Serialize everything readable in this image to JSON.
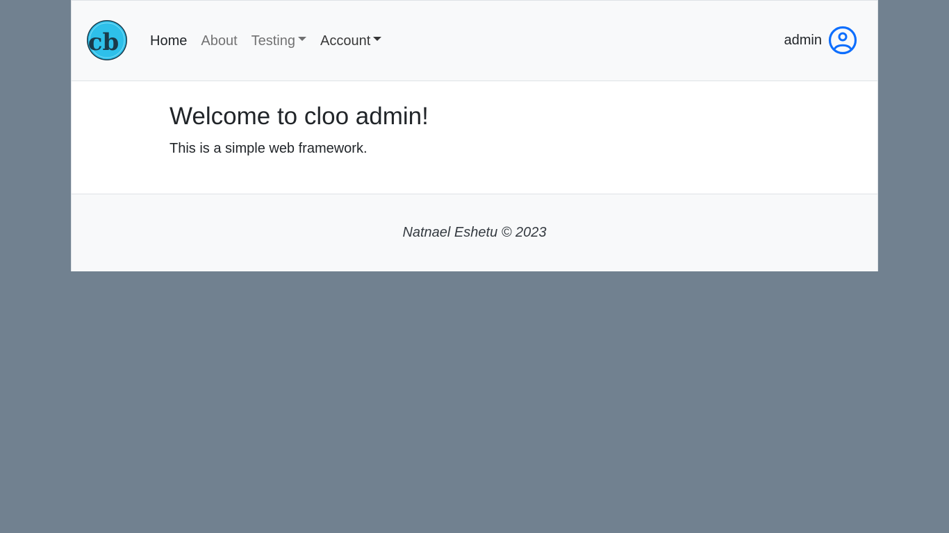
{
  "navbar": {
    "logo_text": "cb",
    "links": [
      {
        "label": "Home"
      },
      {
        "label": "About"
      },
      {
        "label": "Testing"
      },
      {
        "label": "Account"
      }
    ],
    "username": "admin"
  },
  "main": {
    "heading": "Welcome to cloo admin!",
    "lead": "This is a simple web framework."
  },
  "footer": {
    "text": "Natnael Eshetu © 2023"
  },
  "colors": {
    "page_background": "#718190",
    "navbar_background": "#f8f9fa",
    "accent": "#0d6efd",
    "logo_fill": "#2ec0ea"
  },
  "icons": {
    "logo": "cloo-logo",
    "user": "user-circle-icon"
  }
}
